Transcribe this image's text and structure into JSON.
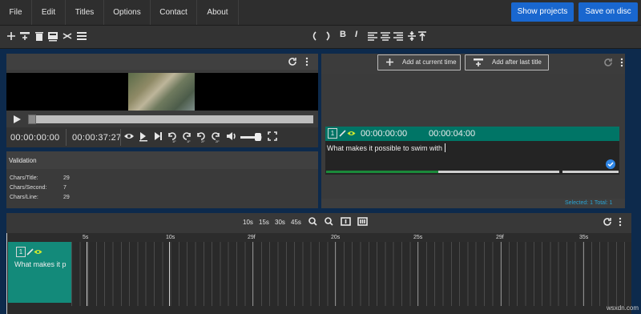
{
  "menu": {
    "items": [
      "File",
      "Edit",
      "Titles",
      "Options",
      "Contact",
      "About"
    ],
    "show_projects": "Show projects",
    "save_on_disc": "Save on disc"
  },
  "toolbar": {
    "icons": [
      "plus-icon",
      "insert-title-icon",
      "delete-icon",
      "merge-icon",
      "split-icon",
      "align-icon"
    ],
    "bold": "B",
    "italic": "I"
  },
  "player": {
    "current_time": "00:00:00:00",
    "duration": "00:00:37:27",
    "controls_sub": [
      "1F",
      "1F",
      "2F",
      "2F"
    ]
  },
  "validation": {
    "title": "Validation",
    "rows": [
      {
        "label": "Chars/Title:",
        "value": "29"
      },
      {
        "label": "Chars/Second:",
        "value": "7"
      },
      {
        "label": "Chars/Line:",
        "value": "29"
      }
    ]
  },
  "titles": {
    "add_current": "Add at current time",
    "add_after_last": "Add after last title",
    "item": {
      "index": "1",
      "start": "00:00:00:00",
      "end": "00:00:04:00",
      "text": "What makes it possible to swim with"
    },
    "status": "Selected: 1 Total: 1"
  },
  "timeline": {
    "zoom_options": [
      "10s",
      "15s",
      "30s",
      "45s"
    ],
    "ruler": [
      "5s",
      "10s",
      "29f",
      "20s",
      "25s",
      "29f",
      "35s"
    ],
    "clip": {
      "index": "1",
      "text": "What makes it p"
    }
  },
  "watermark": "wsxdn.com",
  "colors": {
    "accent": "#007566",
    "button_blue": "#1967cf",
    "clip": "#138a7a"
  }
}
